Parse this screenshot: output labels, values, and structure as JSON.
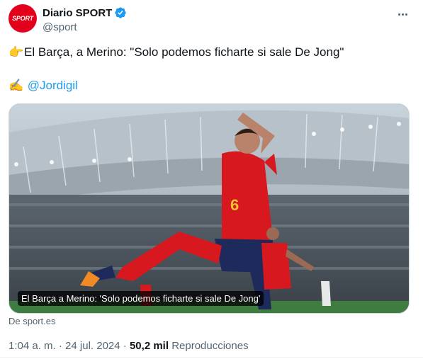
{
  "author": {
    "display_name": "Diario SPORT",
    "handle": "@sport",
    "avatar_text": "SPORT",
    "brand_color": "#e2001a",
    "verified_color": "#1d9bf0"
  },
  "tweet": {
    "line1_emoji": "👉",
    "line1_text": "El Barça, a Merino: \"Solo podemos ficharte si sale De Jong\"",
    "line2_emoji": "✍️",
    "line2_mention": "@Jordigil"
  },
  "media": {
    "caption": "El Barça a Merino: 'Solo podemos ficharte si sale De Jong'",
    "jersey_number": "6"
  },
  "card": {
    "source": "De sport.es"
  },
  "meta": {
    "time": "1:04 a. m.",
    "separator": "·",
    "date": "24 jul. 2024",
    "views_count": "50,2 mil",
    "views_label": "Reproducciones"
  },
  "icons": {
    "verified": "verified-badge-icon",
    "more": "more-options-icon"
  }
}
